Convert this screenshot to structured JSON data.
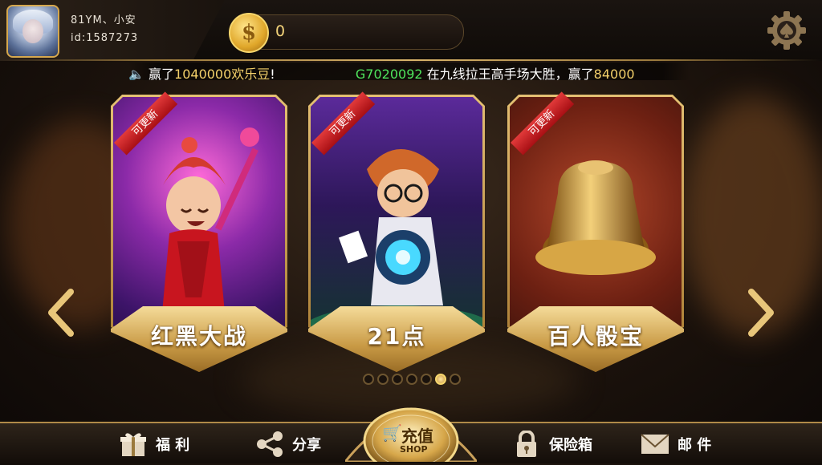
{
  "user": {
    "name": "81YM、小安",
    "id": "id:1587273"
  },
  "coins": {
    "value": "0"
  },
  "marquee": {
    "part1_prefix": "赢了",
    "part1_amount": "1040000欢乐豆",
    "part1_suffix": "!",
    "player": "G7020092",
    "part2_mid": "在九线拉王高手场大胜，赢了",
    "part2_amount": "84000"
  },
  "games": [
    {
      "name": "红黑大战",
      "badge": "可更新"
    },
    {
      "name": "21点",
      "badge": "可更新"
    },
    {
      "name": "百人骰宝",
      "badge": "可更新"
    }
  ],
  "pagination": {
    "total": 7,
    "active_index": 5
  },
  "nav": {
    "welfare": "福 利",
    "share": "分享",
    "recharge": "充值",
    "shop": "SHOP",
    "safe": "保险箱",
    "mail": "邮 件"
  },
  "colors": {
    "gold": "#f3d06a",
    "green": "#4fe45d",
    "ribbon": "#c4181d"
  }
}
